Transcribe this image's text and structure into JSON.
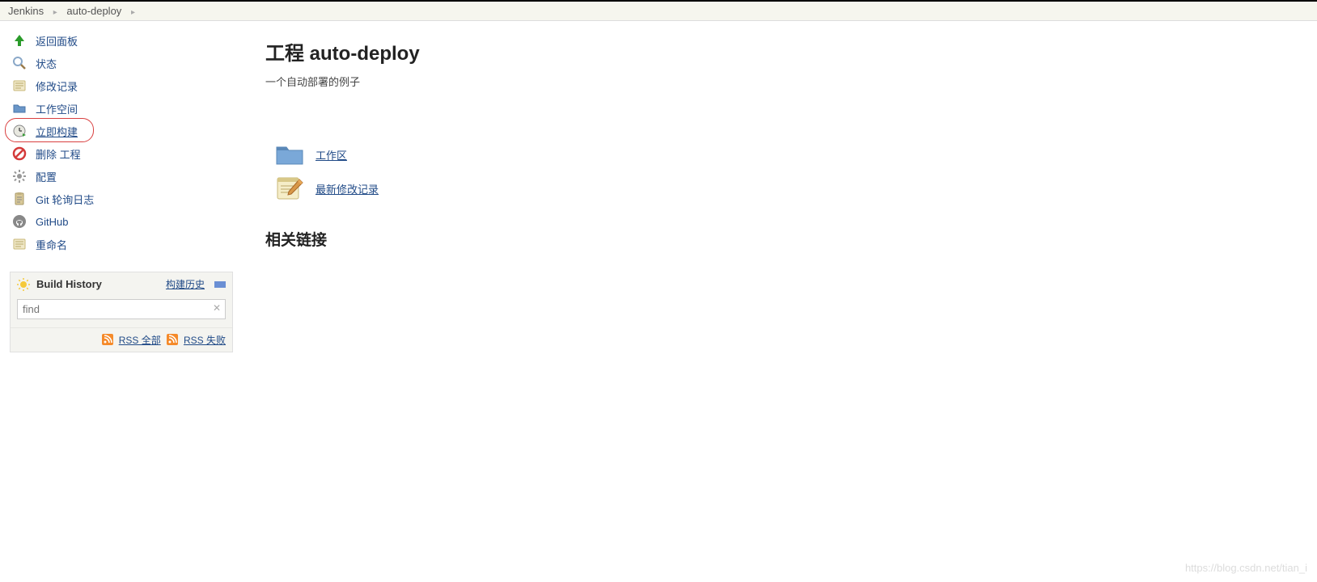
{
  "breadcrumbs": {
    "root": "Jenkins",
    "project": "auto-deploy"
  },
  "sidebar": {
    "items": [
      {
        "label": "返回面板",
        "icon": "arrow-up-icon"
      },
      {
        "label": "状态",
        "icon": "magnifier-icon"
      },
      {
        "label": "修改记录",
        "icon": "notepad-icon"
      },
      {
        "label": "工作空间",
        "icon": "folder-icon"
      },
      {
        "label": "立即构建",
        "icon": "clock-play-icon",
        "highlighted": true
      },
      {
        "label": "删除 工程",
        "icon": "forbidden-icon"
      },
      {
        "label": "配置",
        "icon": "gear-icon"
      },
      {
        "label": "Git 轮询日志",
        "icon": "clipboard-icon"
      },
      {
        "label": "GitHub",
        "icon": "github-icon"
      },
      {
        "label": "重命名",
        "icon": "notepad-icon"
      }
    ]
  },
  "buildHistory": {
    "title": "Build History",
    "trendLink": "构建历史",
    "searchPlaceholder": "find",
    "rssAll": "RSS 全部",
    "rssFail": "RSS 失败"
  },
  "main": {
    "title": "工程 auto-deploy",
    "description": "一个自动部署的例子",
    "links": [
      {
        "label": "工作区",
        "icon": "folder-icon"
      },
      {
        "label": "最新修改记录",
        "icon": "notepad-pencil-icon"
      }
    ],
    "relatedHeading": "相关链接"
  },
  "watermark": "https://blog.csdn.net/tian_i"
}
